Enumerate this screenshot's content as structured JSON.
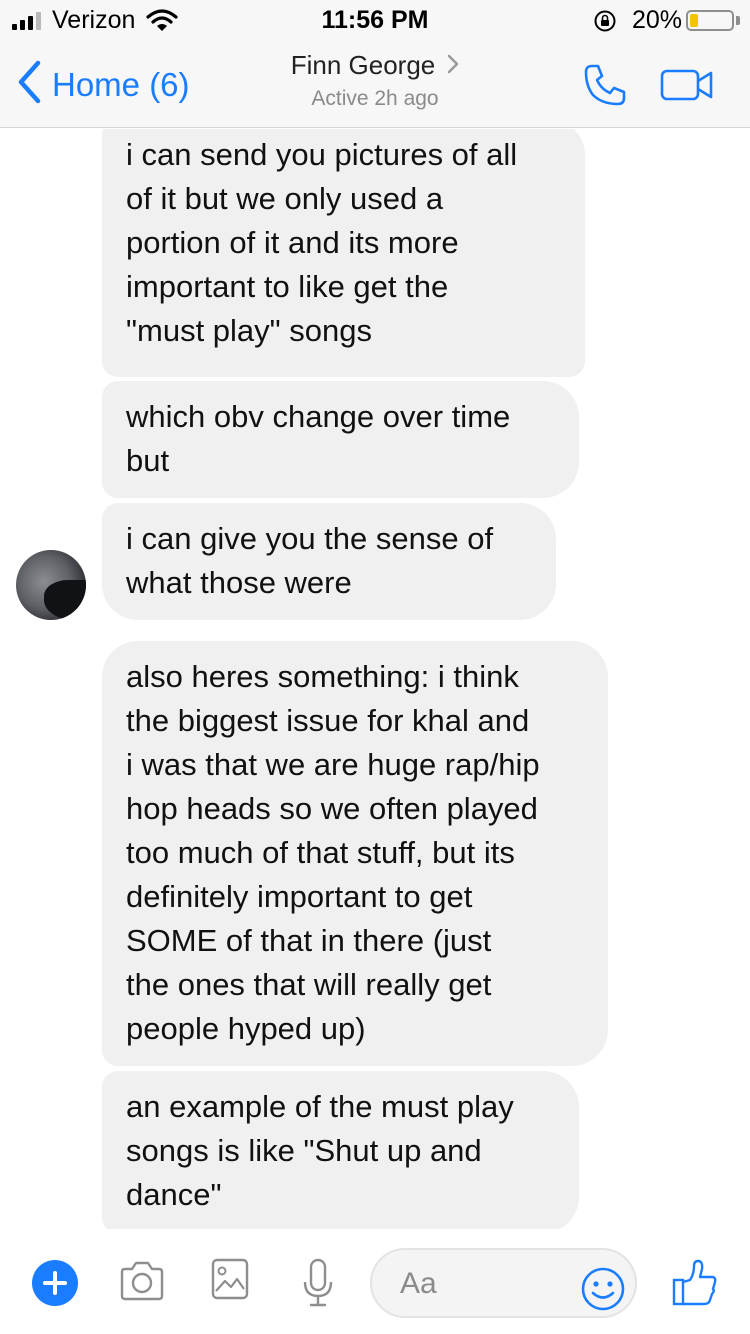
{
  "status_bar": {
    "carrier": "Verizon",
    "time": "11:56 PM",
    "battery_percent": "20%",
    "battery_level": 0.2,
    "signal_bars_active": 3,
    "signal_bars_total": 4
  },
  "nav": {
    "back_label": "Home (6)",
    "contact_name": "Finn George",
    "contact_status": "Active 2h ago"
  },
  "messages": [
    {
      "text": "i can send you pictures of all\nof it but we only used a\nportion of it and its more\nimportant to like get the\n\"must play\" songs"
    },
    {
      "text": "which obv change over time\nbut"
    },
    {
      "text": "i can give you the sense of\nwhat those were"
    },
    {
      "text": "also heres something: i think\nthe biggest issue for khal and\ni was that we are huge rap/hip\nhop heads so we often played\ntoo much of that stuff, but its\ndefinitely important to get\nSOME of that in there (just\nthe ones that will really get\npeople hyped up)"
    },
    {
      "text": "an example of the must play\nsongs is like \"Shut up and\ndance\""
    }
  ],
  "composer": {
    "placeholder": "Aa"
  },
  "colors": {
    "accent": "#1a7dff",
    "bubble": "#f0f0f0",
    "battery": "#f5c400"
  }
}
